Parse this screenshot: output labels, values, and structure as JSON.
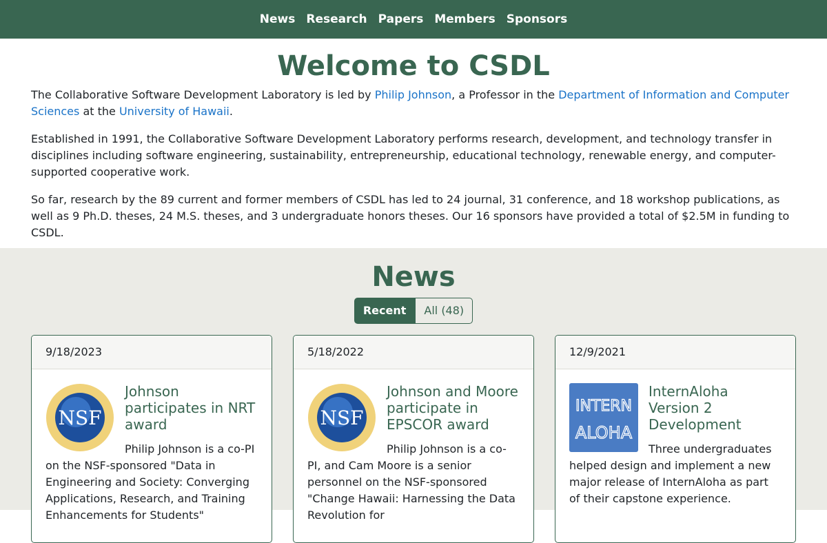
{
  "nav": {
    "items": [
      "News",
      "Research",
      "Papers",
      "Members",
      "Sponsors"
    ]
  },
  "welcome": {
    "title": "Welcome to CSDL",
    "p1_a": "The Collaborative Software Development Laboratory is led by ",
    "p1_link1": "Philip Johnson",
    "p1_b": ", a Professor in the ",
    "p1_link2": "Department of Information and Computer Sciences",
    "p1_c": " at the ",
    "p1_link3": "University of Hawaii",
    "p1_d": ".",
    "p2": "Established in 1991, the Collaborative Software Development Laboratory performs research, development, and technology transfer in disciplines including software engineering, sustainability, entrepreneurship, educational technology, renewable energy, and computer-supported cooperative work.",
    "p3": "So far, research by the 89 current and former members of CSDL has led to 24 journal, 31 conference, and 18 workshop publications, as well as 9 Ph.D. theses, 24 M.S. theses, and 3 undergraduate honors theses. Our 16 sponsors have provided a total of $2.5M in funding to CSDL."
  },
  "news": {
    "title": "News",
    "tab_recent": "Recent",
    "tab_all": "All (48)",
    "cards": [
      {
        "date": "9/18/2023",
        "title": "Johnson participates in NRT award",
        "text": "Philip Johnson is a co-PI on the NSF-sponsored \"Data in Engineering and Society: Converging Applications, Research, and Training Enhancements for Students\"",
        "logo_text": "NSF"
      },
      {
        "date": "5/18/2022",
        "title": "Johnson and Moore participate in EPSCOR award",
        "text": "Philip Johnson is a co-PI, and Cam Moore is a senior personnel on the NSF-sponsored \"Change Hawaii: Harnessing the Data Revolution for",
        "logo_text": "NSF"
      },
      {
        "date": "12/9/2021",
        "title": "InternAloha Version 2 Development",
        "text": "Three undergraduates helped design and implement a new major release of InternAloha as part of their capstone experience.",
        "logo_line1": "INTERN",
        "logo_line2": "ALOHA"
      }
    ]
  },
  "colors": {
    "brand_green": "#396651",
    "link_blue": "#1a73c8",
    "news_bg": "#ebebe6"
  }
}
